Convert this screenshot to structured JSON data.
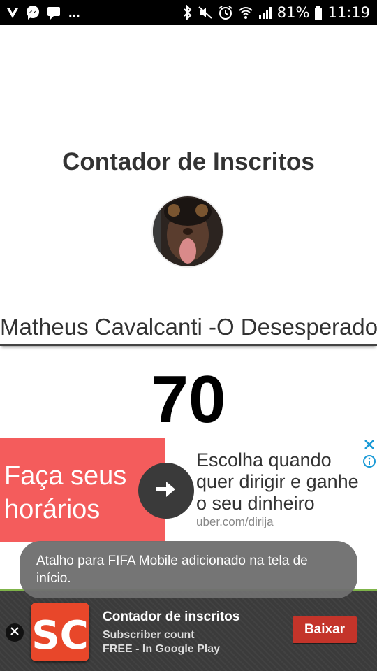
{
  "status_bar": {
    "battery_percent": "81%",
    "time": "11:19",
    "more_indicator": "...",
    "icons_left": [
      "clash-notification-icon",
      "messenger-icon",
      "chat-icon"
    ],
    "icons_right": [
      "bluetooth-icon",
      "mute-icon",
      "alarm-icon",
      "wifi-icon",
      "signal-icon",
      "battery-icon"
    ]
  },
  "page": {
    "title": "Contador de Inscritos",
    "avatar_icon": "channel-avatar",
    "channel_name": "Matheus Cavalcanti -O Desesperado",
    "subscriber_count": "70"
  },
  "ad": {
    "headline": "Faça seus horários",
    "body": "Escolha quando quer dirigir e ganhe o seu dinheiro",
    "url": "uber.com/dirija",
    "accent_color": "#f45c5c",
    "icons": [
      "arrow-right-icon",
      "close-icon",
      "info-icon"
    ]
  },
  "toast": {
    "message": "Atalho para FIFA Mobile adicionado na tela de início."
  },
  "promo": {
    "app_name": "Contador de inscritos",
    "subtitle": "Subscriber count",
    "store_line": "FREE - In Google Play",
    "button_label": "Baixar",
    "icon_letters": "SC",
    "button_color": "#c4342a"
  }
}
